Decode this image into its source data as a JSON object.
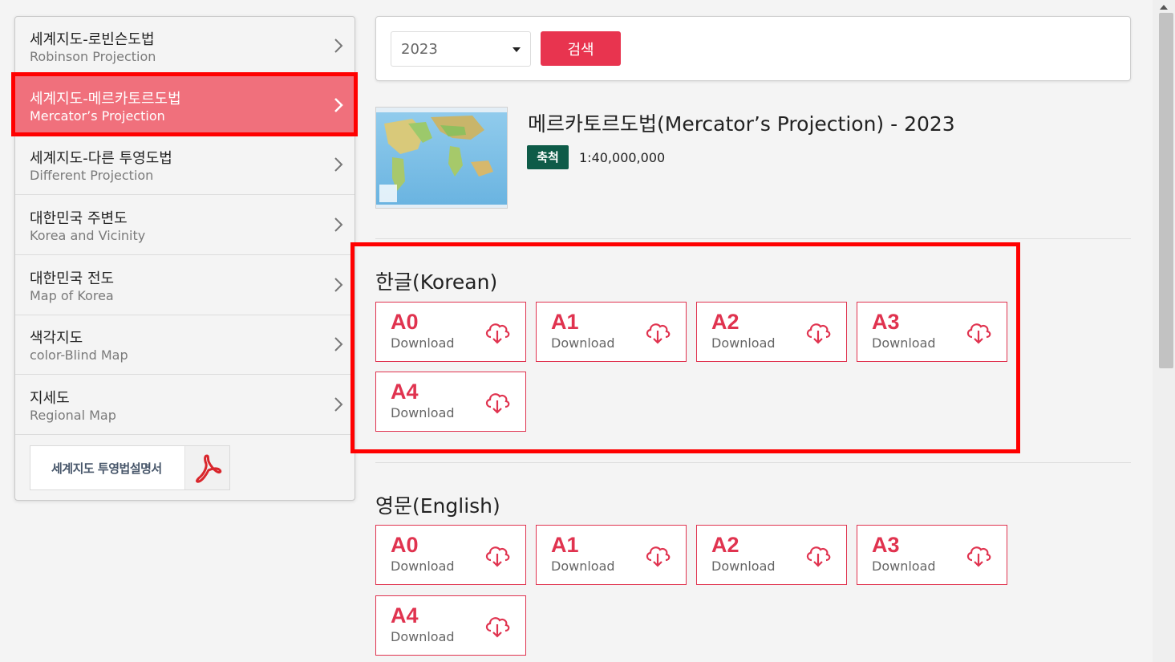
{
  "sidebar": {
    "items": [
      {
        "ko": "세계지도-로빈슨도법",
        "en": "Robinson Projection",
        "active": false
      },
      {
        "ko": "세계지도-메르카토르도법",
        "en": "Mercator’s Projection",
        "active": true
      },
      {
        "ko": "세계지도-다른 투영도법",
        "en": "Different Projection",
        "active": false
      },
      {
        "ko": "대한민국 주변도",
        "en": "Korea and Vicinity",
        "active": false
      },
      {
        "ko": "대한민국 전도",
        "en": "Map of Korea",
        "active": false
      },
      {
        "ko": "색각지도",
        "en": "color-Blind Map",
        "active": false
      },
      {
        "ko": "지세도",
        "en": "Regional Map",
        "active": false
      }
    ],
    "pdf_button": {
      "label": "세계지도 투영법설명서",
      "icon": "pdf-icon"
    }
  },
  "search": {
    "year": "2023",
    "button_label": "검색"
  },
  "map": {
    "title": "메르카토르도법(Mercator’s Projection) - 2023",
    "scale_label": "축척",
    "scale_value": "1:40,000,000"
  },
  "sections": [
    {
      "title": "한글(Korean)",
      "downloads": [
        {
          "size": "A0",
          "label": "Download"
        },
        {
          "size": "A1",
          "label": "Download"
        },
        {
          "size": "A2",
          "label": "Download"
        },
        {
          "size": "A3",
          "label": "Download"
        },
        {
          "size": "A4",
          "label": "Download"
        }
      ]
    },
    {
      "title": "영문(English)",
      "downloads": [
        {
          "size": "A0",
          "label": "Download"
        },
        {
          "size": "A1",
          "label": "Download"
        },
        {
          "size": "A2",
          "label": "Download"
        },
        {
          "size": "A3",
          "label": "Download"
        },
        {
          "size": "A4",
          "label": "Download"
        }
      ]
    }
  ],
  "colors": {
    "accent": "#e8344f",
    "active_item": "#f0707c",
    "badge": "#0e5b48",
    "highlight": "#ff0000"
  }
}
